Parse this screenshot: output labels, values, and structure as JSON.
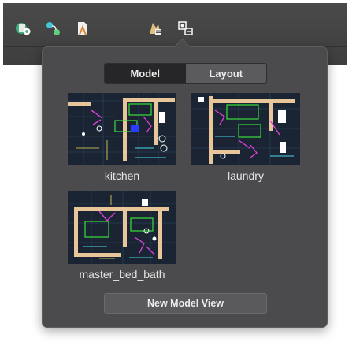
{
  "toolbar": {
    "icons": [
      "paste-drawing-icon",
      "node-share-icon",
      "document-export-icon",
      "layer-settings-icon",
      "model-view-icon"
    ]
  },
  "popover": {
    "tabs": [
      {
        "label": "Model",
        "active": true
      },
      {
        "label": "Layout",
        "active": false
      }
    ],
    "views": [
      {
        "name": "kitchen"
      },
      {
        "name": "laundry"
      },
      {
        "name": "master_bed_bath"
      }
    ],
    "new_view_button": "New Model View"
  },
  "colors": {
    "panel_bg": "#4b4b4d",
    "toolbar_bg": "#444446",
    "thumbnail_bg": "#1b2433",
    "cad_wall": "#e8c69a",
    "cad_magenta": "#e040e0",
    "cad_green": "#38e038",
    "cad_cyan": "#48d8e8",
    "cad_blue": "#2a3cff"
  }
}
